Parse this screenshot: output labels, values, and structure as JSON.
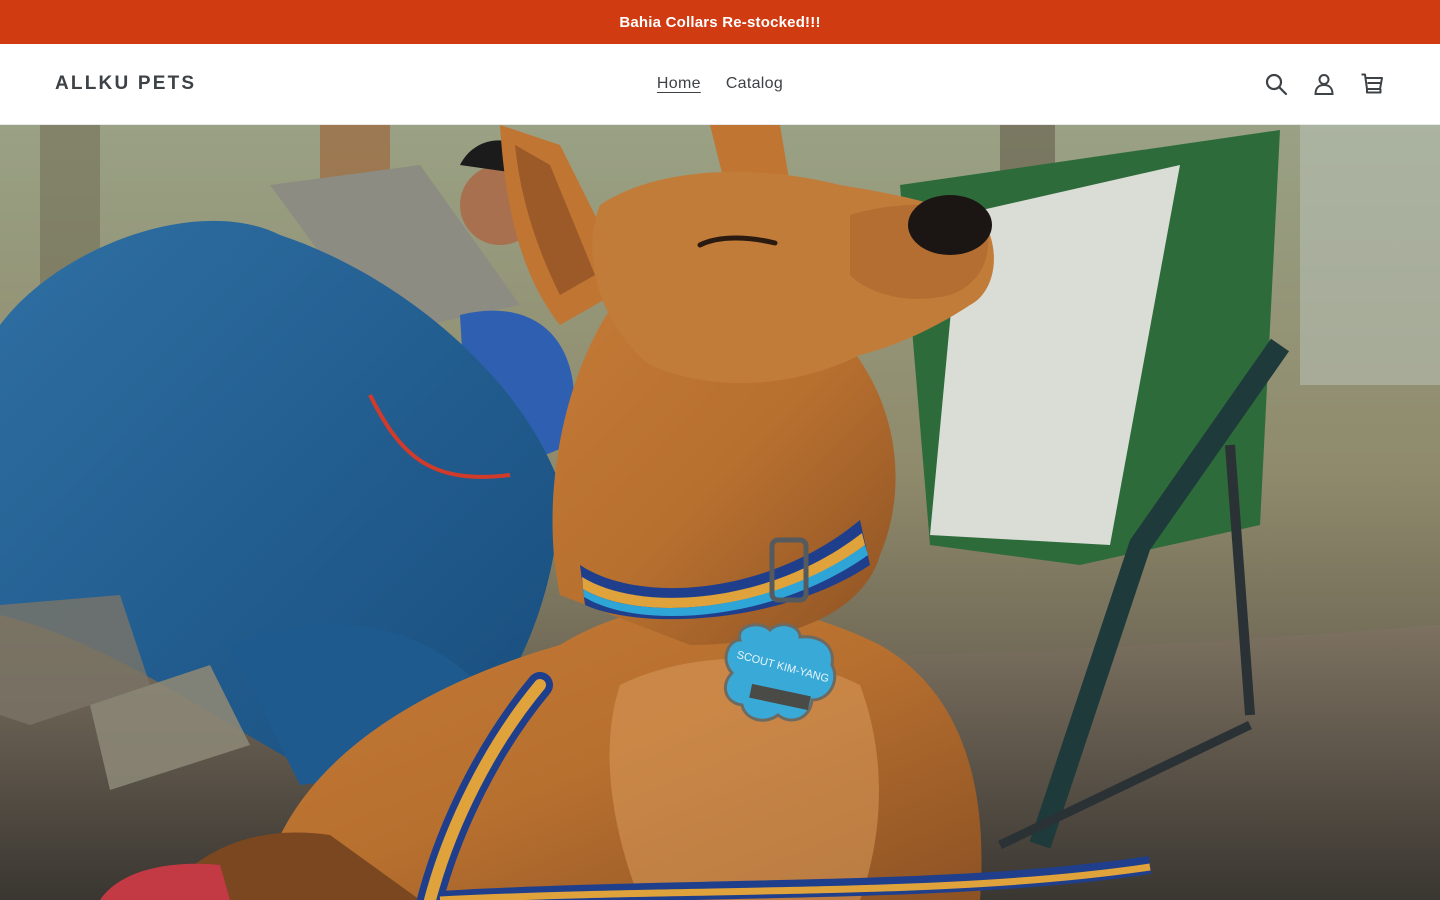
{
  "announcement": {
    "text": "Bahia Collars Re-stocked!!!"
  },
  "header": {
    "logo": "ALLKU PETS",
    "nav": [
      {
        "label": "Home",
        "active": true
      },
      {
        "label": "Catalog",
        "active": false
      }
    ],
    "icons": [
      "search-icon",
      "account-icon",
      "cart-icon"
    ]
  },
  "hero": {
    "image_description_icon": "hero-image",
    "tag_text": "SCOUT KIM-YANG",
    "colors": {
      "announcement_bg": "#d03b12",
      "text": "#3d4246"
    }
  }
}
